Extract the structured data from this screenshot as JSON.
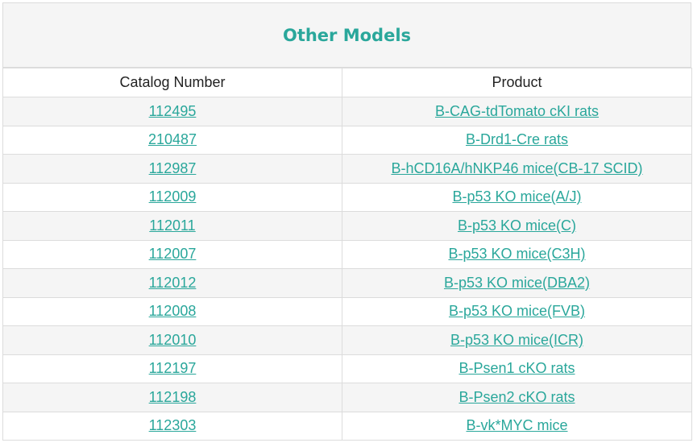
{
  "title": "Other Models",
  "columns": [
    "Catalog Number",
    "Product"
  ],
  "rows": [
    {
      "catalog": "112495",
      "product": "B-CAG-tdTomato cKI rats"
    },
    {
      "catalog": "210487",
      "product": "B-Drd1-Cre rats"
    },
    {
      "catalog": "112987",
      "product": "B-hCD16A/hNKP46 mice(CB-17 SCID)"
    },
    {
      "catalog": "112009",
      "product": "B-p53 KO mice(A/J)"
    },
    {
      "catalog": "112011",
      "product": "B-p53 KO mice(C)"
    },
    {
      "catalog": "112007",
      "product": "B-p53 KO mice(C3H)"
    },
    {
      "catalog": "112012",
      "product": "B-p53 KO mice(DBA2)"
    },
    {
      "catalog": "112008",
      "product": "B-p53 KO mice(FVB)"
    },
    {
      "catalog": "112010",
      "product": "B-p53 KO mice(ICR)"
    },
    {
      "catalog": "112197",
      "product": "B-Psen1 cKO rats"
    },
    {
      "catalog": "112198",
      "product": "B-Psen2 cKO rats"
    },
    {
      "catalog": "112303",
      "product": "B-vk*MYC mice"
    }
  ],
  "colors": {
    "accent": "#2aa79b",
    "stripe": "#f5f5f5",
    "border": "#dcdcdc"
  }
}
